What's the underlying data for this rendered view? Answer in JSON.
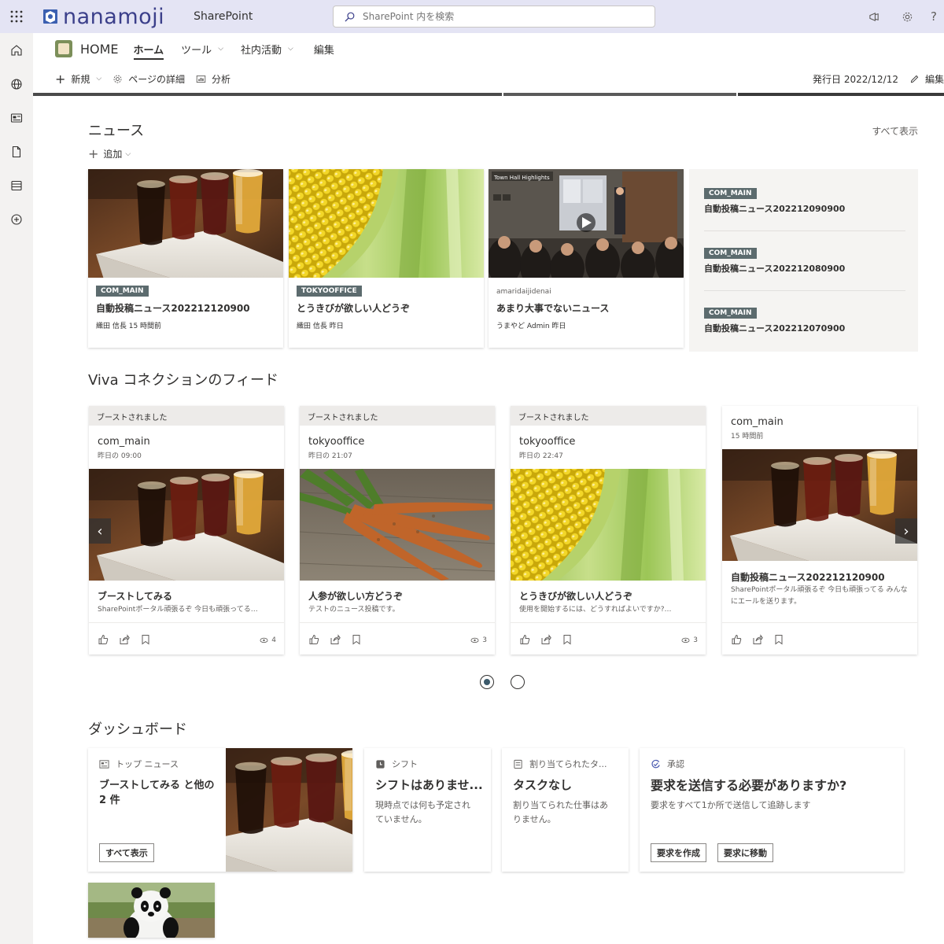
{
  "suite": {
    "brand": "nanamoji",
    "app": "SharePoint",
    "search_placeholder": "SharePoint 内を検索"
  },
  "site": {
    "title": "HOME",
    "nav": [
      {
        "label": "ホーム",
        "active": true
      },
      {
        "label": "ツール",
        "chevron": true
      },
      {
        "label": "社内活動",
        "chevron": true
      },
      {
        "label": "編集"
      }
    ]
  },
  "commandbar": {
    "new": "新規",
    "page_details": "ページの詳細",
    "analytics": "分析",
    "published": "発行日 2022/12/12",
    "edit": "編集"
  },
  "news": {
    "title": "ニュース",
    "see_all": "すべて表示",
    "add": "追加",
    "cards": [
      {
        "tag": "COM_MAIN",
        "title": "自動投稿ニュース202212120900",
        "meta": "織田 信長  15 時間前"
      },
      {
        "tag": "TOKYOOFFICE",
        "title": "とうきびが欲しい人どうぞ",
        "meta": "織田 信長  昨日"
      },
      {
        "source": "amaridaijidenai",
        "title": "あまり大事でないニュース",
        "meta": "うまやど Admin  昨日",
        "video_caption": "Town Hall Highlights"
      }
    ],
    "list": [
      {
        "tag": "COM_MAIN",
        "title": "自動投稿ニュース202212090900"
      },
      {
        "tag": "COM_MAIN",
        "title": "自動投稿ニュース202212080900"
      },
      {
        "tag": "COM_MAIN",
        "title": "自動投稿ニュース202212070900"
      }
    ]
  },
  "viva": {
    "title": "Viva コネクションのフィード",
    "cards": [
      {
        "boost": "ブーストされました",
        "author": "com_main",
        "time": "昨日の 09:00",
        "title": "ブーストしてみる",
        "desc": "SharePointポータル頑張るぞ 今日も頑張ってる…",
        "views": "4"
      },
      {
        "boost": "ブーストされました",
        "author": "tokyooffice",
        "time": "昨日の 21:07",
        "title": "人参が欲しい方どうぞ",
        "desc": "テストのニュース投稿です。",
        "views": "3"
      },
      {
        "boost": "ブーストされました",
        "author": "tokyooffice",
        "time": "昨日の 22:47",
        "title": "とうきびが欲しい人どうぞ",
        "desc": "使用を開始するには、どうすればよいですか?…",
        "views": "3"
      },
      {
        "author": "com_main",
        "time": "15 時間前",
        "title": "自動投稿ニュース202212120900",
        "desc": "SharePointポータル頑張るぞ 今日も頑張ってる みんなにエールを送ります。"
      }
    ]
  },
  "dashboard": {
    "title": "ダッシュボード",
    "top_news": {
      "header": "トップ ニュース",
      "title": "ブーストしてみる と他の 2 件",
      "button": "すべて表示"
    },
    "shift": {
      "header": "シフト",
      "title": "シフトはありませ...",
      "body": "現時点では何も予定されていません。"
    },
    "tasks": {
      "header": "割り当てられたタ...",
      "title": "タスクなし",
      "body": "割り当てられた仕事はありません。"
    },
    "approval": {
      "header": "承認",
      "title": "要求を送信する必要がありますか?",
      "body": "要求をすべて1か所で送信して追跡します",
      "button1": "要求を作成",
      "button2": "要求に移動"
    }
  },
  "colors": {
    "suitebar": "#e4e4f4",
    "rail": "#f3f2f1",
    "tag": "#5c6b6e",
    "brand": "#3b3f8a"
  }
}
